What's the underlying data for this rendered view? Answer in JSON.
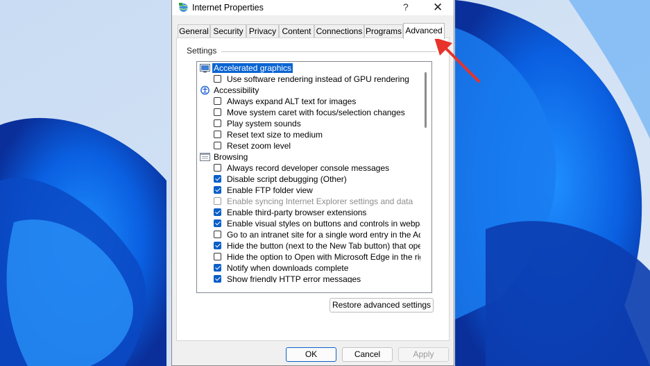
{
  "window": {
    "title": "Internet Properties",
    "help_glyph": "?",
    "close_glyph": "✕"
  },
  "tabs": [
    {
      "label": "General"
    },
    {
      "label": "Security"
    },
    {
      "label": "Privacy"
    },
    {
      "label": "Content"
    },
    {
      "label": "Connections"
    },
    {
      "label": "Programs"
    },
    {
      "label": "Advanced",
      "active": true
    }
  ],
  "settings": {
    "group_label": "Settings",
    "rows": [
      {
        "type": "category",
        "label": "Accelerated graphics",
        "icon": "monitor-icon",
        "selected": true
      },
      {
        "type": "item",
        "label": "Use software rendering instead of GPU rendering",
        "checked": false
      },
      {
        "type": "category",
        "label": "Accessibility",
        "icon": "accessibility-icon"
      },
      {
        "type": "item",
        "label": "Always expand ALT text for images",
        "checked": false
      },
      {
        "type": "item",
        "label": "Move system caret with focus/selection changes",
        "checked": false
      },
      {
        "type": "item",
        "label": "Play system sounds",
        "checked": false
      },
      {
        "type": "item",
        "label": "Reset text size to medium",
        "checked": false
      },
      {
        "type": "item",
        "label": "Reset zoom level",
        "checked": false
      },
      {
        "type": "category",
        "label": "Browsing",
        "icon": "browser-window-icon"
      },
      {
        "type": "item",
        "label": "Always record developer console messages",
        "checked": false
      },
      {
        "type": "item",
        "label": "Disable script debugging (Other)",
        "checked": true
      },
      {
        "type": "item",
        "label": "Enable FTP folder view",
        "checked": true
      },
      {
        "type": "item",
        "label": "Enable syncing Internet Explorer settings and data",
        "checked": false,
        "disabled": true
      },
      {
        "type": "item",
        "label": "Enable third-party browser extensions",
        "checked": true
      },
      {
        "type": "item",
        "label": "Enable visual styles on buttons and controls in webpages",
        "checked": true
      },
      {
        "type": "item",
        "label": "Go to an intranet site for a single word entry in the Address",
        "checked": false
      },
      {
        "type": "item",
        "label": "Hide the button (next to the New Tab button) that opens",
        "checked": true
      },
      {
        "type": "item",
        "label": "Hide the option to Open with Microsoft Edge in the right-cl",
        "checked": false
      },
      {
        "type": "item",
        "label": "Notify when downloads complete",
        "checked": true
      },
      {
        "type": "item",
        "label": "Show friendly HTTP error messages",
        "checked": true
      }
    ],
    "restore_label": "Restore advanced settings"
  },
  "buttons": {
    "ok": "OK",
    "cancel": "Cancel",
    "apply": "Apply"
  },
  "colors": {
    "accent": "#0a64d2",
    "annotation_arrow": "#e8332a",
    "wallpaper": "#0a5fd8"
  }
}
